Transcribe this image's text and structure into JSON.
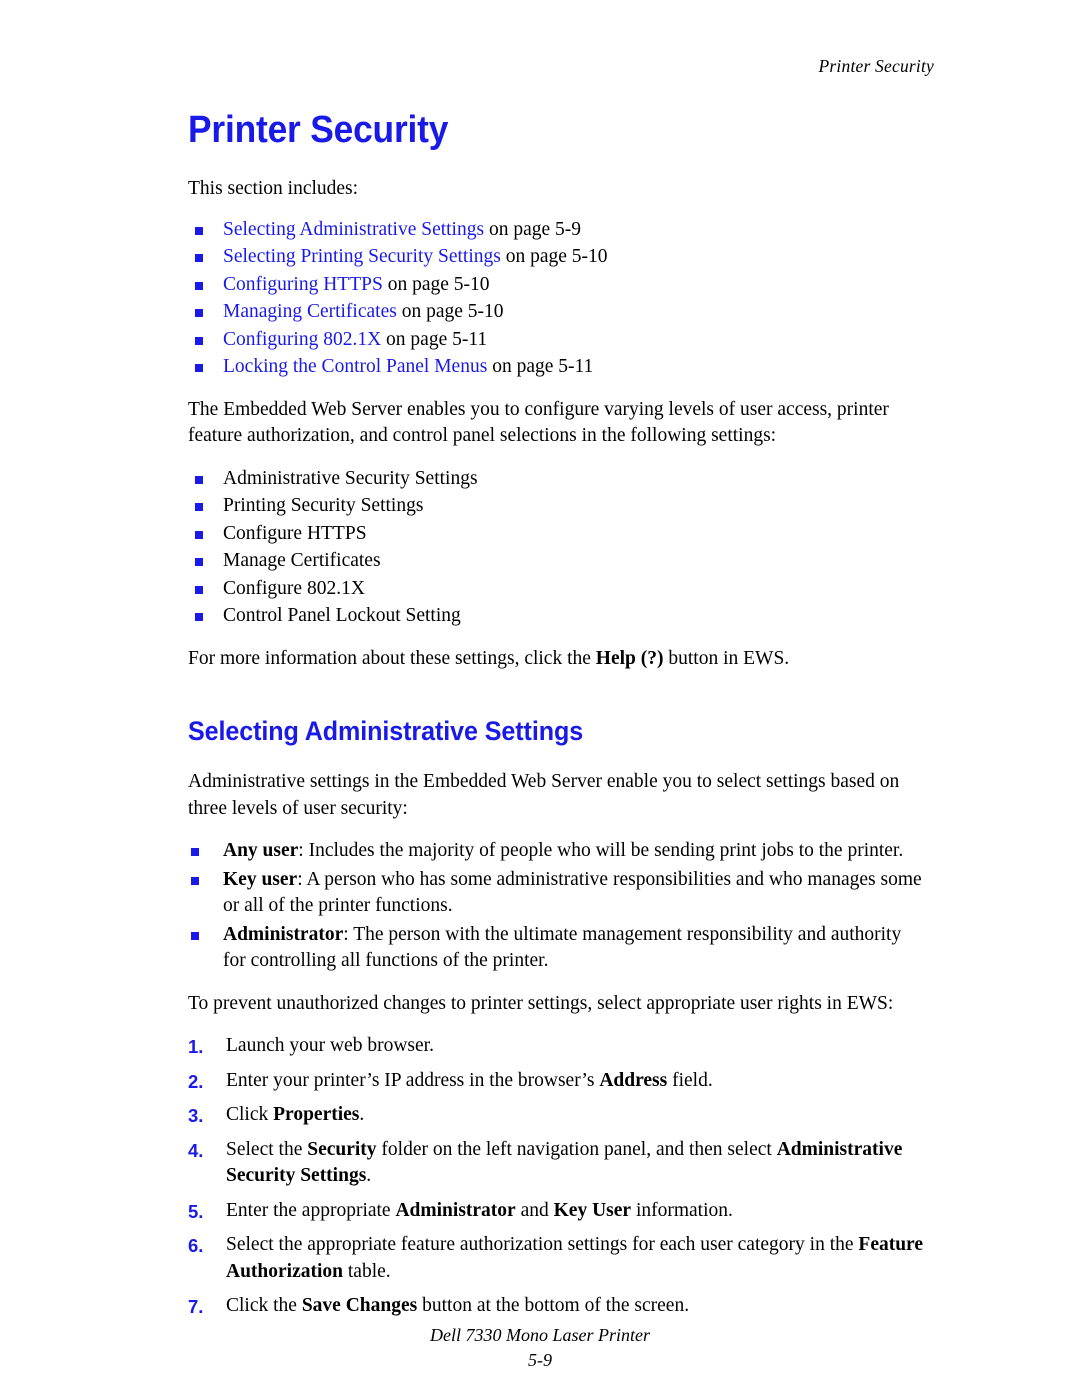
{
  "header": {
    "running_head": "Printer Security"
  },
  "main": {
    "title": "Printer Security",
    "intro_lead": "This section includes:",
    "toc": [
      {
        "link": "Selecting Administrative Settings",
        "tail": " on page 5-9"
      },
      {
        "link": "Selecting Printing Security Settings",
        "tail": " on page 5-10"
      },
      {
        "link": "Configuring HTTPS",
        "tail": " on page 5-10"
      },
      {
        "link": "Managing Certificates",
        "tail": " on page 5-10"
      },
      {
        "link": "Configuring 802.1X",
        "tail": " on page 5-11"
      },
      {
        "link": "Locking the Control Panel Menus",
        "tail": " on page 5-11"
      }
    ],
    "ews_paragraph": "The Embedded Web Server enables you to configure varying levels of user access, printer feature authorization, and control panel selections in the following settings:",
    "settings_list": [
      "Administrative Security Settings",
      "Printing Security Settings",
      "Configure HTTPS",
      "Manage Certificates",
      "Configure 802.1X",
      "Control Panel Lockout Setting"
    ],
    "help_note": {
      "before": "For more information about these settings, click the ",
      "bold": "Help (?)",
      "after": " button in EWS."
    },
    "section2": {
      "title": "Selecting Administrative Settings",
      "intro": "Administrative settings in the Embedded Web Server enable you to select settings based on three levels of user security:",
      "levels": [
        {
          "term": "Any user",
          "desc": ": Includes the majority of people who will be sending print jobs to the printer."
        },
        {
          "term": "Key user",
          "desc": ": A person who has some administrative responsibilities and who manages some or all of the printer functions."
        },
        {
          "term": "Administrator",
          "desc": ": The person with the ultimate management responsibility and authority for controlling all functions of the printer."
        }
      ],
      "steps_lead": "To prevent unauthorized changes to printer settings, select appropriate user rights in EWS:",
      "steps": [
        {
          "num": "1.",
          "parts": [
            {
              "t": "Launch your web browser.",
              "b": false
            }
          ]
        },
        {
          "num": "2.",
          "parts": [
            {
              "t": "Enter your printer’s IP address in the browser’s ",
              "b": false
            },
            {
              "t": "Address",
              "b": true
            },
            {
              "t": " field.",
              "b": false
            }
          ]
        },
        {
          "num": "3.",
          "parts": [
            {
              "t": "Click ",
              "b": false
            },
            {
              "t": "Properties",
              "b": true
            },
            {
              "t": ".",
              "b": false
            }
          ]
        },
        {
          "num": "4.",
          "parts": [
            {
              "t": "Select the ",
              "b": false
            },
            {
              "t": "Security",
              "b": true
            },
            {
              "t": " folder on the left navigation panel, and then select ",
              "b": false
            },
            {
              "t": "Administrative Security Settings",
              "b": true
            },
            {
              "t": ".",
              "b": false
            }
          ]
        },
        {
          "num": "5.",
          "parts": [
            {
              "t": "Enter the appropriate ",
              "b": false
            },
            {
              "t": "Administrator",
              "b": true
            },
            {
              "t": " and ",
              "b": false
            },
            {
              "t": "Key User",
              "b": true
            },
            {
              "t": " information.",
              "b": false
            }
          ]
        },
        {
          "num": "6.",
          "parts": [
            {
              "t": "Select the appropriate feature authorization settings for each user category in the ",
              "b": false
            },
            {
              "t": "Feature Authorization",
              "b": true
            },
            {
              "t": " table.",
              "b": false
            }
          ]
        },
        {
          "num": "7.",
          "parts": [
            {
              "t": "Click the ",
              "b": false
            },
            {
              "t": "Save Changes",
              "b": true
            },
            {
              "t": " button at the bottom of the screen.",
              "b": false
            }
          ]
        }
      ]
    }
  },
  "footer": {
    "product": "Dell 7330 Mono Laser Printer",
    "page_number": "5-9"
  },
  "colors": {
    "accent_blue": "#1a1aE8",
    "text_black": "#000000",
    "page_background": "#ffffff"
  }
}
